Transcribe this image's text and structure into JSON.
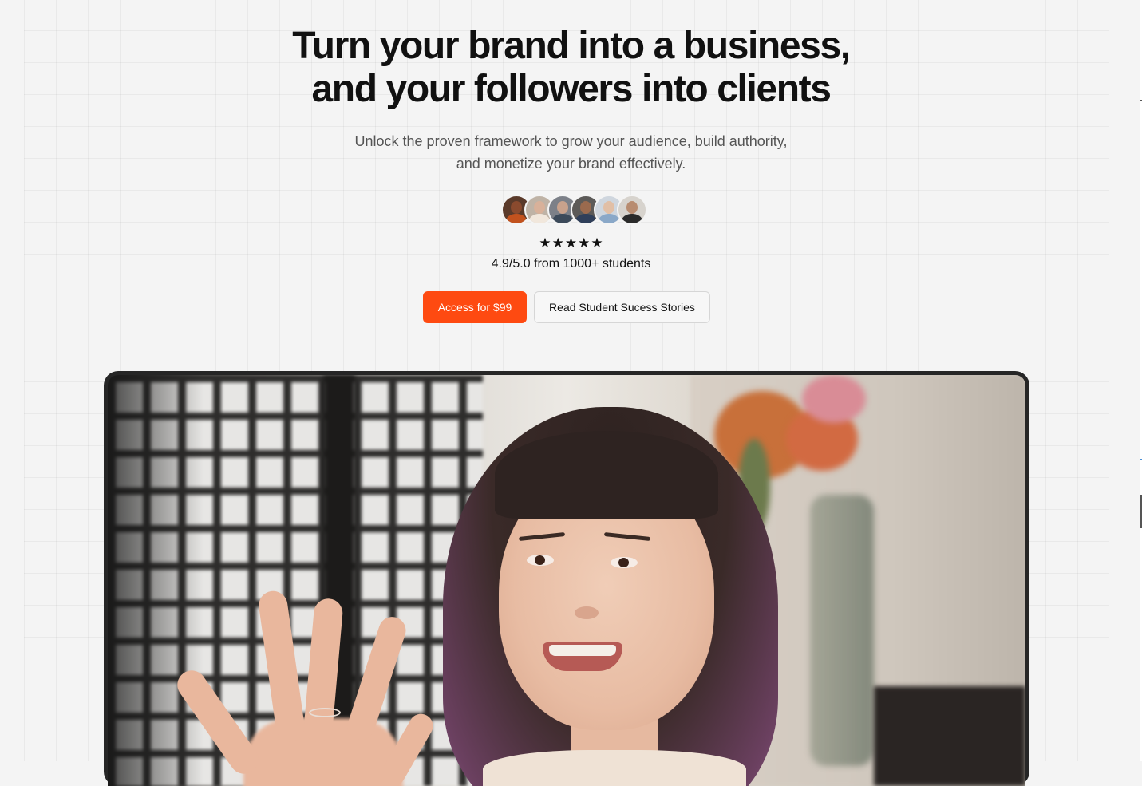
{
  "hero": {
    "headline_line1": "Turn your brand into a business,",
    "headline_line2": "and your followers into clients",
    "subheadline_line1": "Unlock the proven framework to grow your audience, build authority,",
    "subheadline_line2": "and monetize your brand effectively."
  },
  "social_proof": {
    "avatars": [
      {
        "face": "#8a4a2e",
        "body": "#c2521e",
        "bg": "#5a3a2a"
      },
      {
        "face": "#d8b19a",
        "body": "#f1e7dc",
        "bg": "#bfb3a6"
      },
      {
        "face": "#c9a28c",
        "body": "#3c4a5a",
        "bg": "#7c8088"
      },
      {
        "face": "#9a6a4e",
        "body": "#2f3f5a",
        "bg": "#5c5a58"
      },
      {
        "face": "#e1bfa6",
        "body": "#8aa8c8",
        "bg": "#cfd6de"
      },
      {
        "face": "#b88c70",
        "body": "#2a2a2a",
        "bg": "#d7d3cd"
      }
    ],
    "stars": [
      "★",
      "★",
      "★",
      "★",
      "★"
    ],
    "rating_text": "4.9/5.0 from 1000+ students"
  },
  "cta": {
    "primary_label": "Access for $99",
    "secondary_label": "Read Student Sucess Stories"
  },
  "colors": {
    "accent": "#fe4a11",
    "background": "#f4f4f4",
    "text": "#111111",
    "muted_text": "#555555"
  }
}
